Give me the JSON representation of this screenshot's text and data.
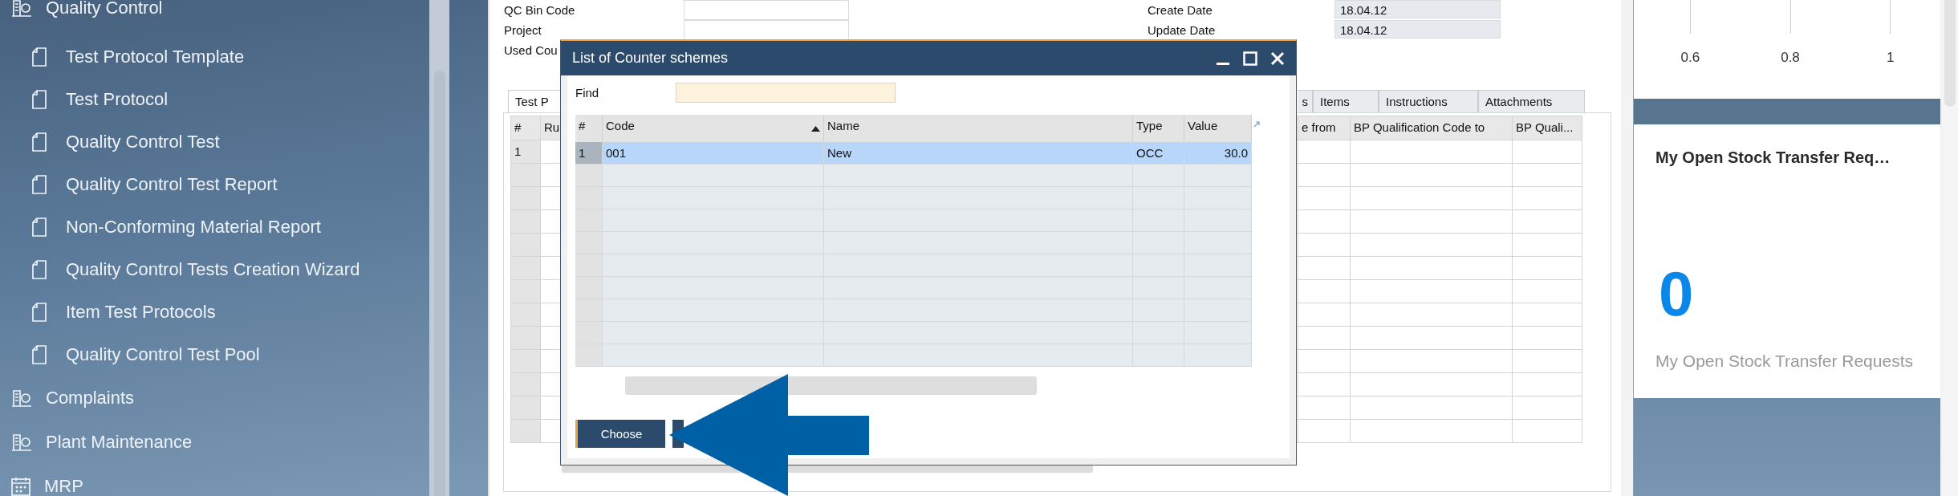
{
  "sidebar": {
    "items": [
      {
        "label": "Quality Control",
        "kind": "module",
        "children": [
          {
            "label": "Test Protocol Template",
            "kind": "form"
          },
          {
            "label": "Test Protocol",
            "kind": "form"
          },
          {
            "label": "Quality Control Test",
            "kind": "form"
          },
          {
            "label": "Quality Control Test Report",
            "kind": "form"
          },
          {
            "label": "Non-Conforming Material Report",
            "kind": "form"
          },
          {
            "label": "Quality Control Tests Creation Wizard",
            "kind": "form"
          },
          {
            "label": "Item Test Protocols",
            "kind": "form"
          },
          {
            "label": "Quality Control Test Pool",
            "kind": "form"
          }
        ]
      },
      {
        "label": "Complaints",
        "kind": "module"
      },
      {
        "label": "Plant Maintenance",
        "kind": "module"
      },
      {
        "label": "MRP",
        "kind": "planning"
      }
    ]
  },
  "form": {
    "left_fields": [
      {
        "label": "QC Bin Code",
        "kind": "field"
      },
      {
        "label": "Project",
        "kind": "field"
      },
      {
        "label": "Used Cou",
        "kind": "label"
      }
    ],
    "right_fields": [
      {
        "label": "Create Date",
        "value": "18.04.12"
      },
      {
        "label": "Update Date",
        "value": "18.04.12"
      }
    ],
    "tabs": [
      {
        "label": "Test P",
        "selected": true
      },
      {
        "label": "s",
        "selected": false
      },
      {
        "label": "Items",
        "selected": false
      },
      {
        "label": "Instructions",
        "selected": false
      },
      {
        "label": "Attachments",
        "selected": false
      }
    ],
    "grid": {
      "columns": [
        "#",
        "Ru",
        "e from",
        "BP Qualification Code to",
        "BP Quali..."
      ],
      "rows": [
        [
          "1"
        ]
      ]
    }
  },
  "dialog": {
    "title": "List of Counter schemes",
    "find_label": "Find",
    "columns": [
      {
        "label": "#",
        "sorted": false
      },
      {
        "label": "Code",
        "sorted": true
      },
      {
        "label": "Name",
        "sorted": false
      },
      {
        "label": "Type",
        "sorted": false
      },
      {
        "label": "Value",
        "sorted": false
      }
    ],
    "rows": [
      {
        "cells": [
          "1",
          "001",
          "New",
          "OCC",
          "30.0"
        ],
        "selected": true
      }
    ],
    "buttons": [
      {
        "label": "Choose"
      }
    ]
  },
  "dashboard": {
    "axis_ticks": [
      "0.6",
      "0.8",
      "1"
    ],
    "card": {
      "title": "My Open Stock Transfer Req…",
      "value": "0",
      "caption": "My Open Stock Transfer Requests"
    }
  }
}
